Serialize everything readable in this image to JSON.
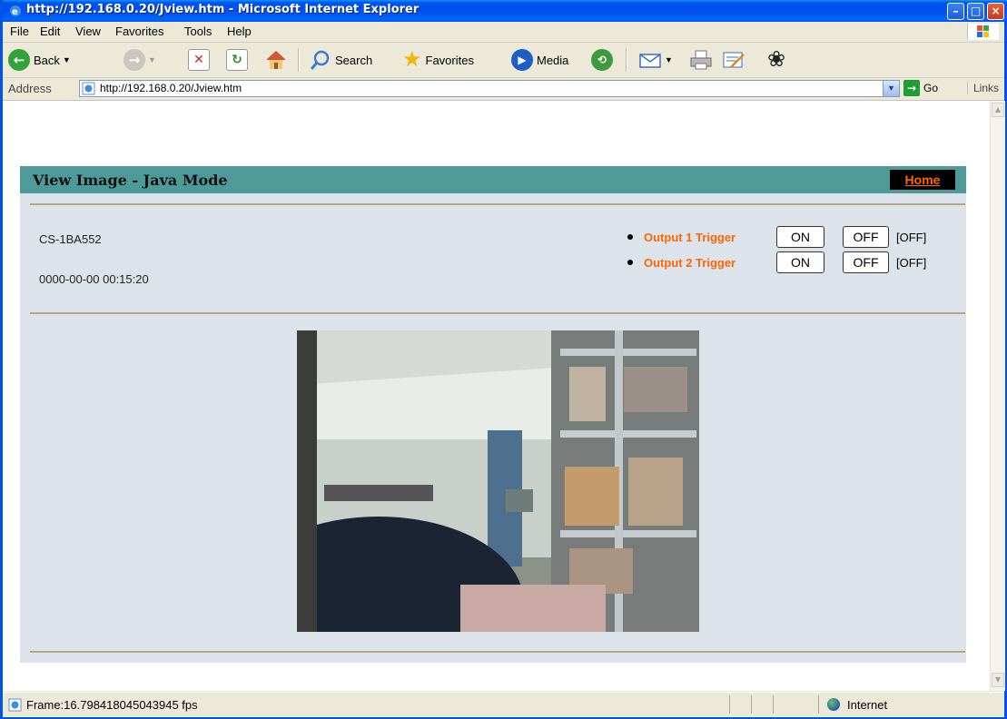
{
  "window": {
    "title": "http://192.168.0.20/Jview.htm - Microsoft Internet Explorer",
    "buttons": [
      "minimize-icon",
      "maximize-icon",
      "close-icon"
    ]
  },
  "menu": {
    "file": "File",
    "edit": "Edit",
    "view": "View",
    "favorites": "Favorites",
    "tools": "Tools",
    "help": "Help"
  },
  "toolbar": {
    "back": "Back",
    "search": "Search",
    "favorites": "Favorites",
    "media": "Media"
  },
  "address": {
    "label": "Address",
    "url": "http://192.168.0.20/Jview.htm",
    "go": "Go",
    "links": "Links"
  },
  "page": {
    "title": "View Image - Java Mode",
    "home": "Home",
    "device_name": "CS-1BA552",
    "datetime": "0000-00-00 00:15:20",
    "outputs": [
      {
        "label": "Output 1 Trigger",
        "on": "ON",
        "off": "OFF",
        "state": "[OFF]"
      },
      {
        "label": "Output 2 Trigger",
        "on": "ON",
        "off": "OFF",
        "state": "[OFF]"
      }
    ],
    "accent_color": "#ff6600",
    "header_color": "#4d9a99"
  },
  "status": {
    "text": "Frame:16.798418045043945 fps",
    "zone": "Internet"
  }
}
